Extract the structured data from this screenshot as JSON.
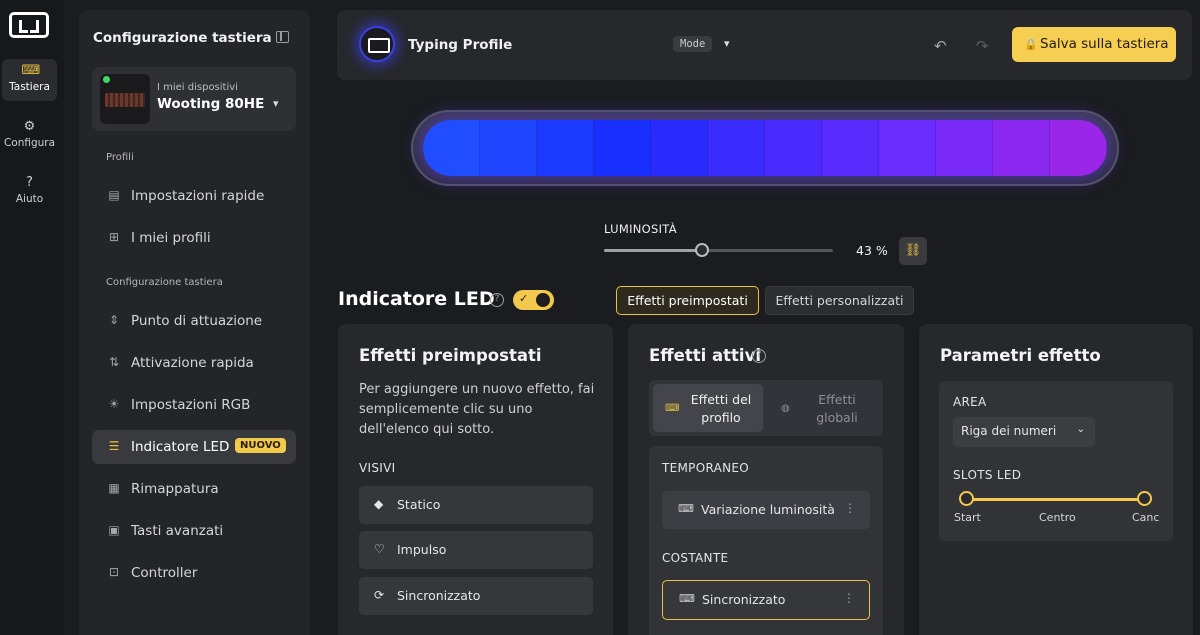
{
  "rail": {
    "items": [
      {
        "label": "Tastiera",
        "icon": "keyboard-icon"
      },
      {
        "label": "Configura",
        "icon": "gear-icon"
      },
      {
        "label": "Aiuto",
        "icon": "help-icon"
      }
    ]
  },
  "sidebar": {
    "title": "Configurazione tastiera",
    "device": {
      "subtitle": "I miei dispositivi",
      "name": "Wooting 80HE"
    },
    "section_profiles": "Profili",
    "profiles_items": [
      {
        "label": "Impostazioni rapide"
      },
      {
        "label": "I miei profili"
      }
    ],
    "section_config": "Configurazione tastiera",
    "config_items": [
      {
        "label": "Punto di attuazione"
      },
      {
        "label": "Attivazione rapida"
      },
      {
        "label": "Impostazioni RGB"
      },
      {
        "label": "Indicatore LED",
        "badge": "NUOVO"
      },
      {
        "label": "Rimappatura"
      },
      {
        "label": "Tasti avanzati"
      },
      {
        "label": "Controller"
      }
    ]
  },
  "topbar": {
    "profile_name": "Typing Profile",
    "mode_label": "Mode",
    "save_label": "Salva sulla tastiera"
  },
  "led_preview": {
    "colors": [
      "#1f4dff",
      "#1f45ff",
      "#1c3aff",
      "#1a30ff",
      "#2a2cff",
      "#3a2bff",
      "#4a2aff",
      "#5a2bff",
      "#6a2bfd",
      "#7a2af6",
      "#8a28ef",
      "#9a26e8"
    ]
  },
  "brightness": {
    "label": "LUMINOSITÀ",
    "value_text": "43 %",
    "value": 43
  },
  "led_section": {
    "title": "Indicatore LED",
    "tab_preset": "Effetti preimpostati",
    "tab_custom": "Effetti personalizzati"
  },
  "preset_card": {
    "title": "Effetti preimpostati",
    "description": "Per aggiungere un nuovo effetto, fai semplicemente clic su uno dell'elenco qui sotto.",
    "section_label": "VISIVI",
    "effects": [
      {
        "label": "Statico"
      },
      {
        "label": "Impulso"
      },
      {
        "label": "Sincronizzato"
      }
    ]
  },
  "active_card": {
    "title": "Effetti attivi",
    "tab_profile": "Effetti del profilo",
    "tab_global": "Effetti globali",
    "temp_label": "TEMPORANEO",
    "temp_effect": "Variazione luminosità",
    "const_label": "COSTANTE",
    "const_effect": "Sincronizzato"
  },
  "params_card": {
    "title": "Parametri effetto",
    "area_label": "AREA",
    "area_value": "Riga dei numeri",
    "slots_label": "SLOTS LED",
    "range_labels": [
      "Start",
      "Centro",
      "Canc"
    ]
  },
  "colors": {
    "accent": "#f2c94c",
    "background": "#1b1c1f"
  }
}
